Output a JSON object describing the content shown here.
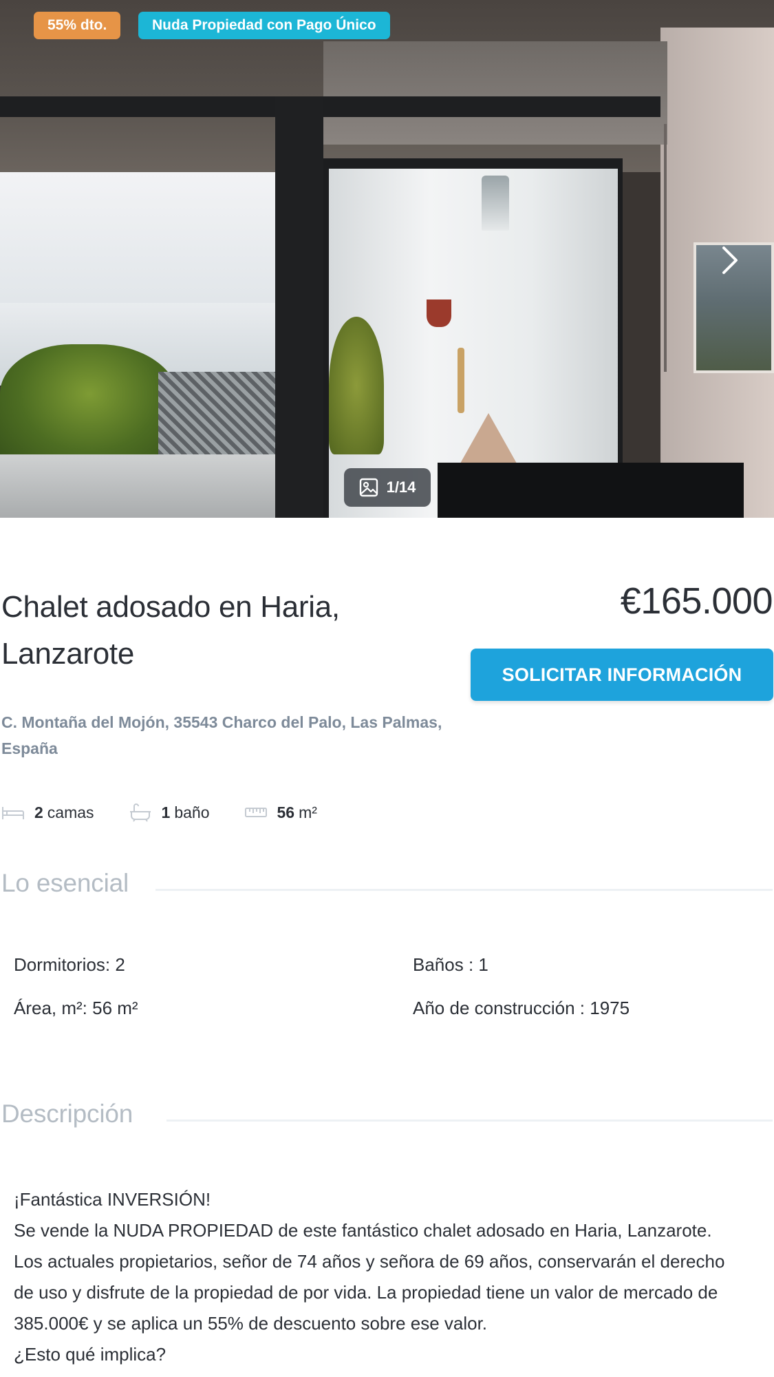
{
  "gallery": {
    "badges": {
      "discount": "55% dto.",
      "type": "Nuda Propiedad con Pago Único"
    },
    "counter": "1/14",
    "icons": {
      "next": "chevron-right-icon",
      "counter": "image-icon"
    },
    "colors": {
      "discount_badge": "#e69447",
      "type_badge": "#1cb6d6"
    }
  },
  "listing": {
    "title_line1": "Chalet adosado en Haria,",
    "title_line2": "Lanzarote",
    "price": "€165.000",
    "cta_label": "SOLICITAR INFORMACIÓN",
    "address_line1": "C. Montaña del Mojón, 35543 Charco del Palo, Las Palmas,",
    "address_line2": "España",
    "cta_color": "#1ea3dc"
  },
  "features": {
    "beds": {
      "value": "2",
      "unit": "camas",
      "icon": "bed-icon"
    },
    "baths": {
      "value": "1",
      "unit": "baño",
      "icon": "bathtub-icon"
    },
    "area": {
      "value": "56",
      "unit": "m²",
      "icon": "ruler-icon"
    }
  },
  "essentials": {
    "title": "Lo esencial",
    "items": [
      "Dormitorios: 2",
      "Baños : 1",
      "Área, m²: 56 m²",
      "Año de construcción : 1975"
    ]
  },
  "description": {
    "title": "Descripción",
    "lines": [
      "¡Fantástica INVERSIÓN!",
      "Se vende la NUDA PROPIEDAD de este fantástico chalet adosado en Haria, Lanzarote.",
      "Los actuales propietarios, señor de 74 años y señora de 69 años, conservarán el derecho",
      "de uso y disfrute de la propiedad de por vida. La propiedad tiene un valor de mercado de",
      "385.000€ y se aplica un 55% de descuento sobre ese valor.",
      "¿Esto qué implica?"
    ]
  }
}
